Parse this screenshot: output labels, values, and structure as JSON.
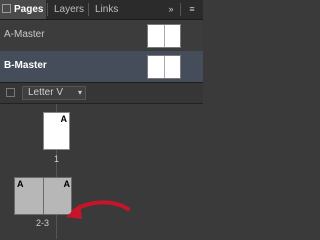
{
  "tabs": [
    {
      "label": "Pages",
      "active": true
    },
    {
      "label": "Layers",
      "active": false
    },
    {
      "label": "Links",
      "active": false
    }
  ],
  "panel_menu": {
    "expand": "»",
    "menu": "≡"
  },
  "masters": [
    {
      "label": "A-Master",
      "selected": false
    },
    {
      "label": "B-Master",
      "selected": true
    }
  ],
  "page_size": {
    "value": "Letter V",
    "arrow": "▾"
  },
  "pages": {
    "page1": {
      "letter": "A",
      "number": "1"
    },
    "spread": {
      "left_letter": "A",
      "right_letter": "A",
      "number": "2-3"
    }
  },
  "colors": {
    "accent_arrow": "#c8142b",
    "selected_row": "#464d5a"
  },
  "icons": [
    "close-icon",
    "panel-menu-icon",
    "double-chevron-icon",
    "page-size-icon",
    "red-arrow-annotation"
  ]
}
